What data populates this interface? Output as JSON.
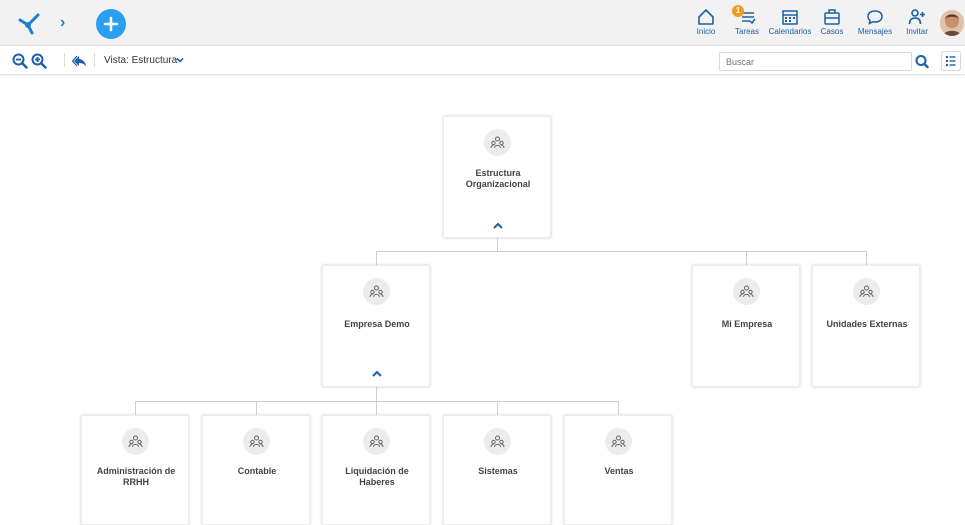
{
  "header": {
    "nav": [
      {
        "id": "inicio",
        "label": "Inicio",
        "icon": "home-icon"
      },
      {
        "id": "tareas",
        "label": "Tareas",
        "icon": "tasks-icon",
        "badge": "1"
      },
      {
        "id": "calendarios",
        "label": "Calendarios",
        "icon": "calendar-icon"
      },
      {
        "id": "casos",
        "label": "Casos",
        "icon": "briefcase-icon"
      },
      {
        "id": "mensajes",
        "label": "Mensajes",
        "icon": "chat-icon"
      },
      {
        "id": "invitar",
        "label": "Invitar",
        "icon": "invite-user-icon"
      }
    ]
  },
  "toolbar": {
    "view_label": "Vista: Estructura",
    "search_placeholder": "Buscar"
  },
  "org": {
    "root": {
      "name": "Estructura Organizacional"
    },
    "level1": [
      {
        "name": "Empresa Demo"
      },
      {
        "name": "Mi Empresa"
      },
      {
        "name": "Unidades Externas"
      }
    ],
    "level2": [
      {
        "name": "Administración de RRHH"
      },
      {
        "name": "Contable"
      },
      {
        "name": "Liquidación de Haberes"
      },
      {
        "name": "Sistemas"
      },
      {
        "name": "Ventas"
      }
    ]
  },
  "colors": {
    "accent": "#1d5fa8",
    "plus": "#2a9ff0",
    "badge": "#f39a1f"
  }
}
